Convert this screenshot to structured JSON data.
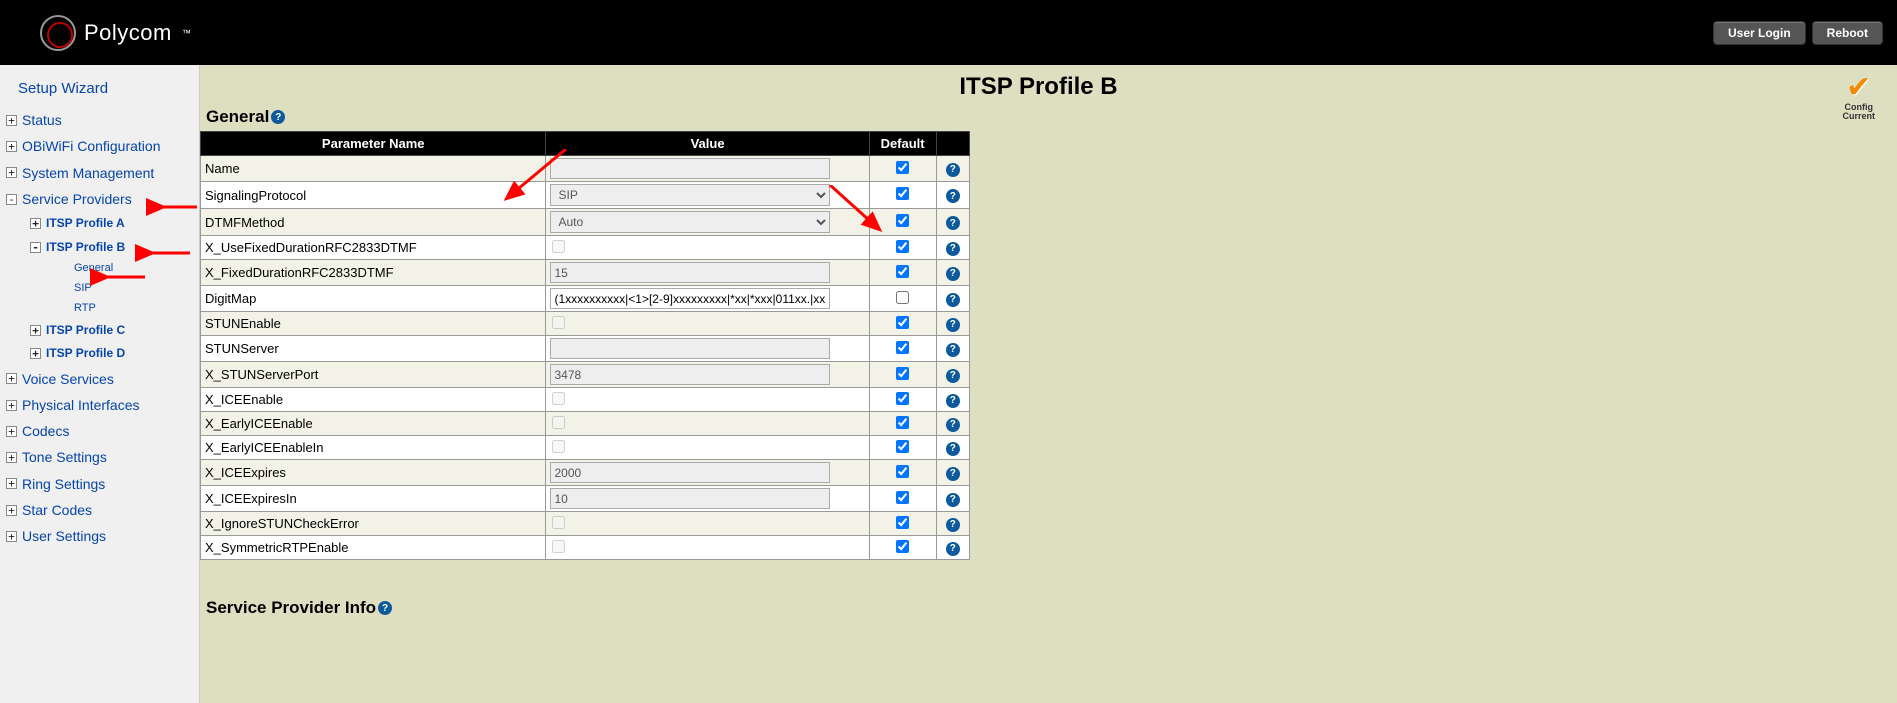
{
  "header": {
    "brand": "Polycom",
    "user_login": "User Login",
    "reboot": "Reboot"
  },
  "sidebar": {
    "setup_wizard": "Setup Wizard",
    "items": [
      {
        "exp": "+",
        "label": "Status"
      },
      {
        "exp": "+",
        "label": "OBiWiFi Configuration"
      },
      {
        "exp": "+",
        "label": "System Management"
      },
      {
        "exp": "-",
        "label": "Service Providers"
      },
      {
        "exp": "+",
        "label": "Voice Services"
      },
      {
        "exp": "+",
        "label": "Physical Interfaces"
      },
      {
        "exp": "+",
        "label": "Codecs"
      },
      {
        "exp": "+",
        "label": "Tone Settings"
      },
      {
        "exp": "+",
        "label": "Ring Settings"
      },
      {
        "exp": "+",
        "label": "Star Codes"
      },
      {
        "exp": "+",
        "label": "User Settings"
      }
    ],
    "sp_children": [
      {
        "exp": "+",
        "label": "ITSP Profile A"
      },
      {
        "exp": "-",
        "label": "ITSP Profile B"
      },
      {
        "exp": "+",
        "label": "ITSP Profile C"
      },
      {
        "exp": "+",
        "label": "ITSP Profile D"
      }
    ],
    "profile_b_children": [
      {
        "label": "General"
      },
      {
        "label": "SIP"
      },
      {
        "label": "RTP"
      }
    ]
  },
  "status_badge": {
    "line1": "Config",
    "line2": "Current"
  },
  "page": {
    "title": "ITSP Profile B",
    "section_general": "General",
    "section_sp_info": "Service Provider Info"
  },
  "table": {
    "headers": {
      "name": "Parameter Name",
      "value": "Value",
      "default": "Default",
      "help": ""
    },
    "rows": [
      {
        "name": "Name",
        "type": "text",
        "value": "",
        "default": true
      },
      {
        "name": "SignalingProtocol",
        "type": "select",
        "value": "SIP",
        "default": true
      },
      {
        "name": "DTMFMethod",
        "type": "select",
        "value": "Auto",
        "default": true
      },
      {
        "name": "X_UseFixedDurationRFC2833DTMF",
        "type": "check",
        "value": false,
        "default": true
      },
      {
        "name": "X_FixedDurationRFC2833DTMF",
        "type": "text",
        "value": "15",
        "default": true
      },
      {
        "name": "DigitMap",
        "type": "text",
        "value": "(1xxxxxxxxxx|<1>[2-9]xxxxxxxxx|*xx|*xxx|011xx.|xx",
        "default": false
      },
      {
        "name": "STUNEnable",
        "type": "check",
        "value": false,
        "default": true
      },
      {
        "name": "STUNServer",
        "type": "text",
        "value": "",
        "default": true
      },
      {
        "name": "X_STUNServerPort",
        "type": "text",
        "value": "3478",
        "default": true
      },
      {
        "name": "X_ICEEnable",
        "type": "check",
        "value": false,
        "default": true
      },
      {
        "name": "X_EarlyICEEnable",
        "type": "check",
        "value": false,
        "default": true
      },
      {
        "name": "X_EarlyICEEnableIn",
        "type": "check",
        "value": false,
        "default": true
      },
      {
        "name": "X_ICEExpires",
        "type": "text",
        "value": "2000",
        "default": true
      },
      {
        "name": "X_ICEExpiresIn",
        "type": "text",
        "value": "10",
        "default": true
      },
      {
        "name": "X_IgnoreSTUNCheckError",
        "type": "check",
        "value": false,
        "default": true
      },
      {
        "name": "X_SymmetricRTPEnable",
        "type": "check",
        "value": false,
        "default": true
      }
    ]
  }
}
